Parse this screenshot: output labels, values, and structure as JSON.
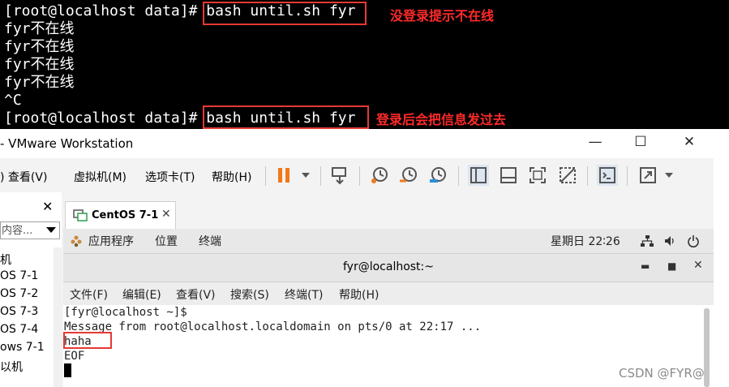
{
  "top_terminal": {
    "lines": [
      "[root@localhost data]# bash until.sh fyr",
      "fyr不在线",
      "fyr不在线",
      "fyr不在线",
      "fyr不在线",
      "^C",
      "[root@localhost data]# bash until.sh fyr"
    ],
    "annotations": [
      "没登录提示不在线",
      "登录后会把信息发过去"
    ]
  },
  "vmware": {
    "title": "- VMware Workstation",
    "menu": [
      ") 查看(V)",
      "虚拟机(M)",
      "选项卡(T)",
      "帮助(H)"
    ],
    "library": {
      "search_placeholder": "内容...",
      "items": [
        "机",
        "OS 7-1",
        "OS 7-2",
        "OS 7-3",
        "OS 7-4",
        "ows 7-1",
        "以机"
      ]
    },
    "tab_label": "CentOS 7-1"
  },
  "guest": {
    "gnome_bar": {
      "apps": "应用程序",
      "places": "位置",
      "terminal": "终端",
      "clock": "星期日 22∶26"
    },
    "terminal_window": {
      "title": "fyr@localhost:~",
      "menu": [
        "文件(F)",
        "编辑(E)",
        "查看(V)",
        "搜索(S)",
        "终端(T)",
        "帮助(H)"
      ],
      "lines": [
        "[fyr@localhost ~]$",
        "Message from root@localhost.localdomain on pts/0 at 22:17 ...",
        "haha",
        "EOF"
      ]
    }
  },
  "watermark": "CSDN @FYR@",
  "colors": {
    "annotation_red": "#e53935",
    "pause_orange": "#f07a1a"
  }
}
